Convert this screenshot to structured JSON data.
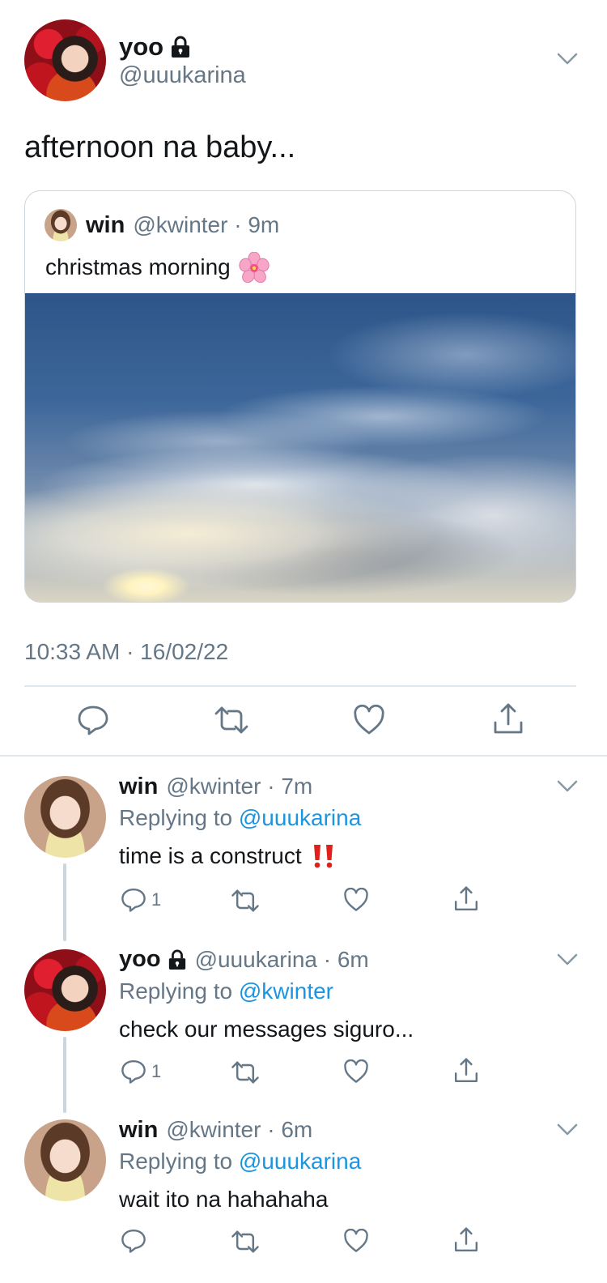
{
  "main_tweet": {
    "display_name": "yoo",
    "handle": "@uuukarina",
    "text": "afternoon na baby...",
    "timestamp": "10:33 AM · 16/02/22",
    "quoted": {
      "display_name": "win",
      "handle_time": "@kwinter · 9m",
      "text": "christmas morning",
      "emoji": "🌸"
    }
  },
  "replies": [
    {
      "display_name": "win",
      "handle_time": "@kwinter · 7m",
      "replying_prefix": "Replying to",
      "replying_to": "@uuukarina",
      "text": "time is a construct",
      "emoji": "‼️",
      "reply_count": "1"
    },
    {
      "display_name": "yoo",
      "handle_time": "@uuukarina · 6m",
      "replying_prefix": "Replying to",
      "replying_to": "@kwinter",
      "text": "check our messages siguro...",
      "emoji": "",
      "reply_count": "1"
    },
    {
      "display_name": "win",
      "handle_time": "@kwinter · 6m",
      "replying_prefix": "Replying to",
      "replying_to": "@uuukarina",
      "text": "wait ito na hahahaha",
      "emoji": "",
      "reply_count": ""
    }
  ],
  "icons": {
    "lock": "lock-icon",
    "chevron": "chevron-down-icon",
    "reply": "reply-icon",
    "retweet": "retweet-icon",
    "like": "heart-icon",
    "share": "share-icon"
  },
  "colors": {
    "link": "#1b95e0",
    "secondary": "#657786",
    "text": "#14171a",
    "divider": "#e1e8ed"
  }
}
